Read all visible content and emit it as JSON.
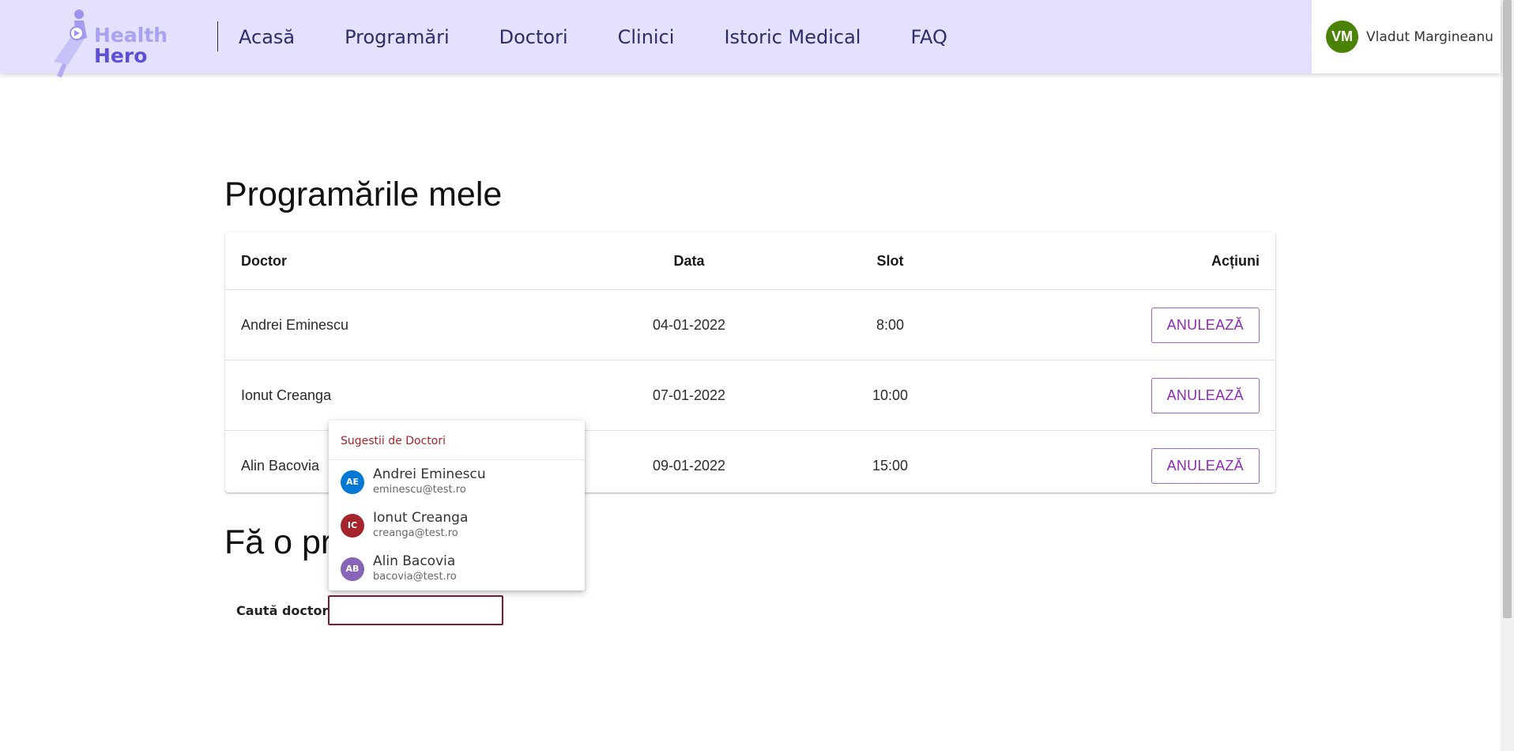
{
  "logo": {
    "line1": "Health",
    "line2": "Hero"
  },
  "nav": [
    "Acasă",
    "Programări",
    "Doctori",
    "Clinici",
    "Istoric Medical",
    "FAQ"
  ],
  "user": {
    "initials": "VM",
    "name": "Vladut Margineanu",
    "avatar_color": "#498205"
  },
  "appointments": {
    "title": "Programările mele",
    "headers": {
      "doctor": "Doctor",
      "date": "Data",
      "slot": "Slot",
      "actions": "Acțiuni"
    },
    "rows": [
      {
        "doctor": "Andrei Eminescu",
        "date": "04-01-2022",
        "slot": "8:00",
        "action": "ANULEAZĂ"
      },
      {
        "doctor": "Ionut Creanga",
        "date": "07-01-2022",
        "slot": "10:00",
        "action": "ANULEAZĂ"
      },
      {
        "doctor": "Alin Bacovia",
        "date": "09-01-2022",
        "slot": "15:00",
        "action": "ANULEAZĂ"
      }
    ]
  },
  "new_appointment": {
    "title": "Fă o programare",
    "search_label": "Caută doctor",
    "search_value": ""
  },
  "suggestions": {
    "header": "Sugestii de Doctori",
    "items": [
      {
        "initials": "AE",
        "name": "Andrei Eminescu",
        "email": "eminescu@test.ro",
        "color": "#0078d4"
      },
      {
        "initials": "IC",
        "name": "Ionut Creanga",
        "email": "creanga@test.ro",
        "color": "#a4262c"
      },
      {
        "initials": "AB",
        "name": "Alin Bacovia",
        "email": "bacovia@test.ro",
        "color": "#8764b8"
      }
    ]
  },
  "colors": {
    "header_bg": "#e3e1fd",
    "nav_text": "#2d2d6b",
    "cancel_button": "#8e2ab8"
  }
}
